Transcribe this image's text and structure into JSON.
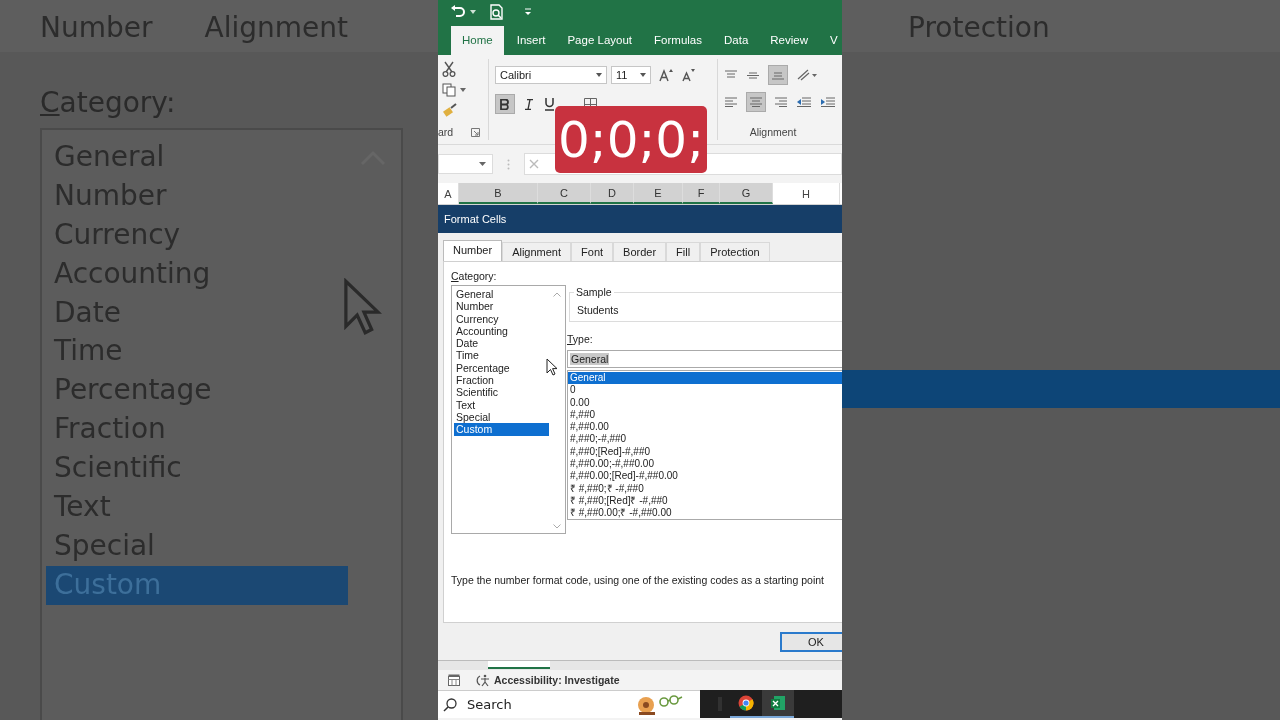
{
  "backdrop_left": {
    "tabs": [
      "Number",
      "Alignment"
    ],
    "category_label": "Category:",
    "categories": [
      {
        "label": "General",
        "selected": false
      },
      {
        "label": "Number",
        "selected": false
      },
      {
        "label": "Currency",
        "selected": false
      },
      {
        "label": "Accounting",
        "selected": false
      },
      {
        "label": "Date",
        "selected": false
      },
      {
        "label": "Time",
        "selected": false
      },
      {
        "label": "Percentage",
        "selected": false
      },
      {
        "label": "Fraction",
        "selected": false
      },
      {
        "label": "Scientific",
        "selected": false
      },
      {
        "label": "Text",
        "selected": false
      },
      {
        "label": "Special",
        "selected": false
      },
      {
        "label": "Custom",
        "selected": true
      }
    ]
  },
  "backdrop_right": {
    "tab": "Protection"
  },
  "ribbon": {
    "tabs": [
      {
        "label": "Home",
        "selected": true
      },
      {
        "label": "Insert",
        "selected": false
      },
      {
        "label": "Page Layout",
        "selected": false
      },
      {
        "label": "Formulas",
        "selected": false
      },
      {
        "label": "Data",
        "selected": false
      },
      {
        "label": "Review",
        "selected": false
      },
      {
        "label": "V",
        "selected": false
      }
    ],
    "font_name": "Calibri",
    "font_size": "11",
    "bold": true,
    "align_bottom": true,
    "align_center": true,
    "group_labels": [
      "ard",
      "Alignment"
    ]
  },
  "caption": "0;0;0;",
  "columns": [
    {
      "label": "A",
      "selected": false
    },
    {
      "label": "B",
      "selected": true
    },
    {
      "label": "C",
      "selected": true
    },
    {
      "label": "D",
      "selected": true
    },
    {
      "label": "E",
      "selected": true
    },
    {
      "label": "F",
      "selected": true
    },
    {
      "label": "G",
      "selected": true
    },
    {
      "label": "H",
      "selected": false
    }
  ],
  "dialog": {
    "title": "Format Cells",
    "tabs": [
      {
        "label": "Number",
        "selected": true
      },
      {
        "label": "Alignment",
        "selected": false
      },
      {
        "label": "Font",
        "selected": false
      },
      {
        "label": "Border",
        "selected": false
      },
      {
        "label": "Fill",
        "selected": false
      },
      {
        "label": "Protection",
        "selected": false
      }
    ],
    "category_label": "Category:",
    "categories": [
      {
        "label": "General",
        "selected": false
      },
      {
        "label": "Number",
        "selected": false
      },
      {
        "label": "Currency",
        "selected": false
      },
      {
        "label": "Accounting",
        "selected": false
      },
      {
        "label": "Date",
        "selected": false
      },
      {
        "label": "Time",
        "selected": false
      },
      {
        "label": "Percentage",
        "selected": false
      },
      {
        "label": "Fraction",
        "selected": false
      },
      {
        "label": "Scientific",
        "selected": false
      },
      {
        "label": "Text",
        "selected": false
      },
      {
        "label": "Special",
        "selected": false
      },
      {
        "label": "Custom",
        "selected": true
      }
    ],
    "sample_label": "Sample",
    "sample_value": "Students",
    "type_label": "Type:",
    "type_value": "General",
    "type_options": [
      {
        "label": "General",
        "selected": true
      },
      {
        "label": "0",
        "selected": false
      },
      {
        "label": "0.00",
        "selected": false
      },
      {
        "label": "#,##0",
        "selected": false
      },
      {
        "label": "#,##0.00",
        "selected": false
      },
      {
        "label": "#,##0;-#,##0",
        "selected": false
      },
      {
        "label": "#,##0;[Red]-#,##0",
        "selected": false
      },
      {
        "label": "#,##0.00;-#,##0.00",
        "selected": false
      },
      {
        "label": "#,##0.00;[Red]-#,##0.00",
        "selected": false
      },
      {
        "label": "₹ #,##0;₹ -#,##0",
        "selected": false
      },
      {
        "label": "₹ #,##0;[Red]₹ -#,##0",
        "selected": false
      },
      {
        "label": "₹ #,##0.00;₹ -#,##0.00",
        "selected": false
      }
    ],
    "description": "Type the number format code, using one of the existing codes as a starting point",
    "ok": "OK"
  },
  "status_bar": {
    "accessibility": "Accessibility: Investigate"
  },
  "taskbar": {
    "search": {
      "placeholder": "Search"
    }
  }
}
